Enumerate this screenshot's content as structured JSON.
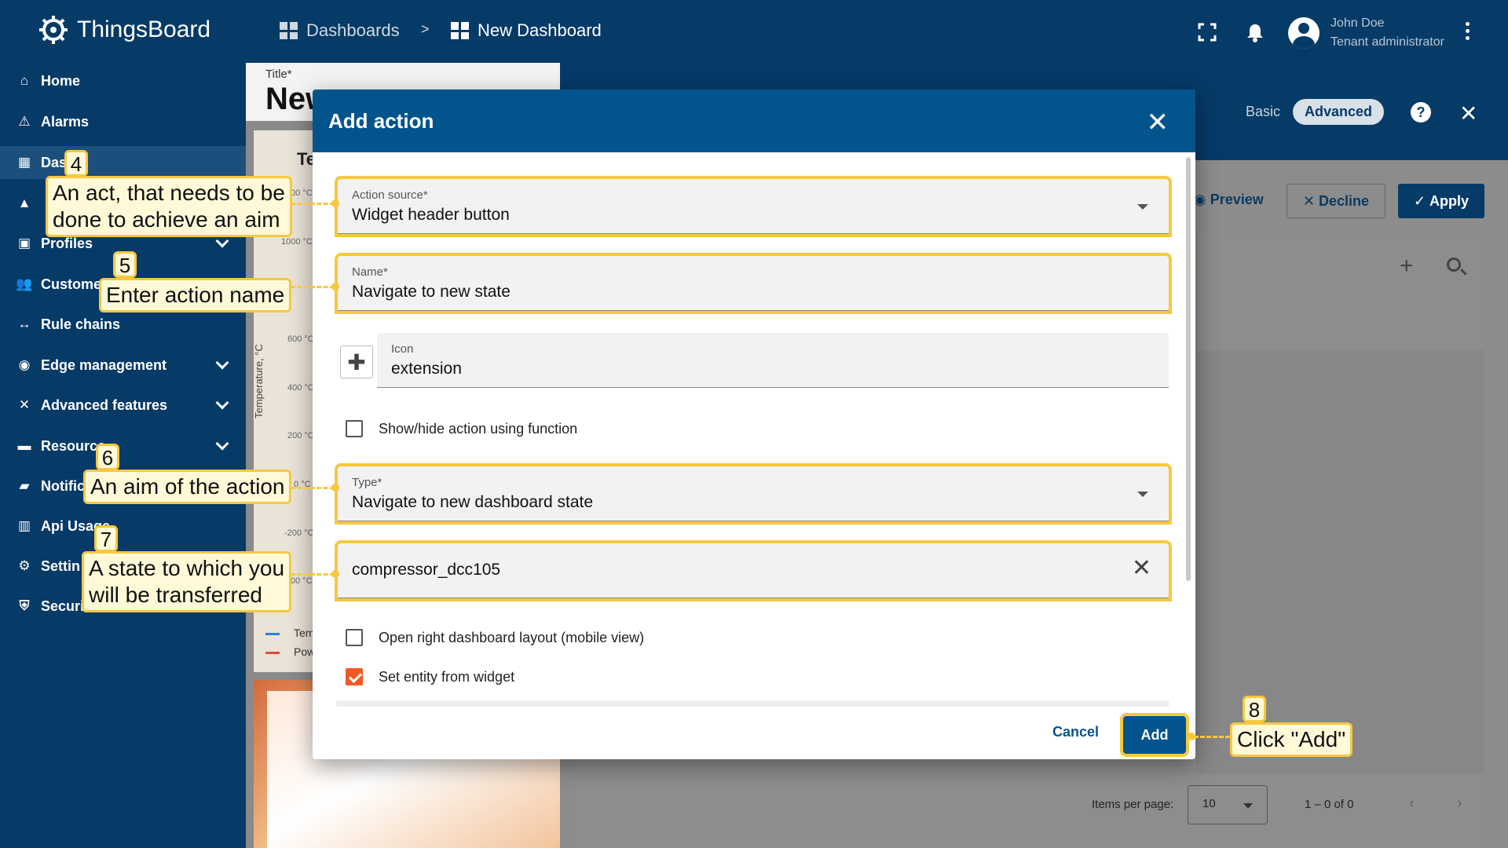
{
  "app": {
    "name": "ThingsBoard"
  },
  "breadcrumb": {
    "first": "Dashboards",
    "separator": ">",
    "second": "New Dashboard"
  },
  "user": {
    "name": "John Doe",
    "role": "Tenant administrator"
  },
  "sidebar": {
    "items": [
      {
        "label": "Home",
        "icon": "home-icon"
      },
      {
        "label": "Alarms",
        "icon": "warning-icon"
      },
      {
        "label": "Das",
        "icon": "dashboard-icon"
      },
      {
        "label": "",
        "icon": "entities-icon"
      },
      {
        "label": "Profiles",
        "icon": "profiles-icon"
      },
      {
        "label": "Custome",
        "icon": "customers-icon"
      },
      {
        "label": "Rule chains",
        "icon": "rule-chain-icon"
      },
      {
        "label": "Edge management",
        "icon": "edge-icon"
      },
      {
        "label": "Advanced features",
        "icon": "tools-icon"
      },
      {
        "label": "Resource",
        "icon": "folder-icon"
      },
      {
        "label": "Notific",
        "icon": "notification-icon"
      },
      {
        "label": "Api Usage",
        "icon": "chart-icon"
      },
      {
        "label": "Settin",
        "icon": "gear-icon"
      },
      {
        "label": "Securi",
        "icon": "shield-icon"
      }
    ]
  },
  "background": {
    "title_label": "Title*",
    "title_value": "New",
    "chart_title": "Te",
    "ticks": [
      "00 °C",
      "1000 °C",
      "600 °C",
      "400 °C",
      "200 °C",
      "0 °C",
      "-200 °C",
      "00 °C"
    ],
    "axis_label": "Temperature, °C",
    "legend": [
      "Tem",
      "Pow"
    ],
    "mode_basic": "Basic",
    "mode_advanced": "Advanced",
    "preview": "Preview",
    "decline": "Decline",
    "apply": "Apply",
    "items_per_page_label": "Items per page:",
    "items_per_page": "10",
    "range": "1 – 0 of 0"
  },
  "dialog": {
    "title": "Add action",
    "action_source": {
      "label": "Action source*",
      "value": "Widget header button"
    },
    "name": {
      "label": "Name*",
      "value": "Navigate to new state"
    },
    "icon": {
      "label": "Icon",
      "value": "extension"
    },
    "show_hide": {
      "label": "Show/hide action using function",
      "checked": false
    },
    "type": {
      "label": "Type*",
      "value": "Navigate to new dashboard state"
    },
    "state": {
      "value": "compressor_dcc105"
    },
    "open_right": {
      "label": "Open right dashboard layout (mobile view)",
      "checked": false
    },
    "set_entity": {
      "label": "Set entity from widget",
      "checked": true
    },
    "cancel": "Cancel",
    "add": "Add"
  },
  "callouts": [
    {
      "num": "4",
      "line1": "An act, that needs to be",
      "line2": "done to achieve an aim"
    },
    {
      "num": "5",
      "line1": "Enter action name",
      "line2": ""
    },
    {
      "num": "6",
      "line1": "An aim of the action",
      "line2": ""
    },
    {
      "num": "7",
      "line1": "A state to which you",
      "line2": "will be transferred"
    },
    {
      "num": "8",
      "line1": "Click \"Add\"",
      "line2": ""
    }
  ],
  "colors": {
    "primary": "#063a67",
    "dialog_header": "#03548c",
    "highlight": "#f7c83f",
    "checkbox": "#ef5a24"
  }
}
